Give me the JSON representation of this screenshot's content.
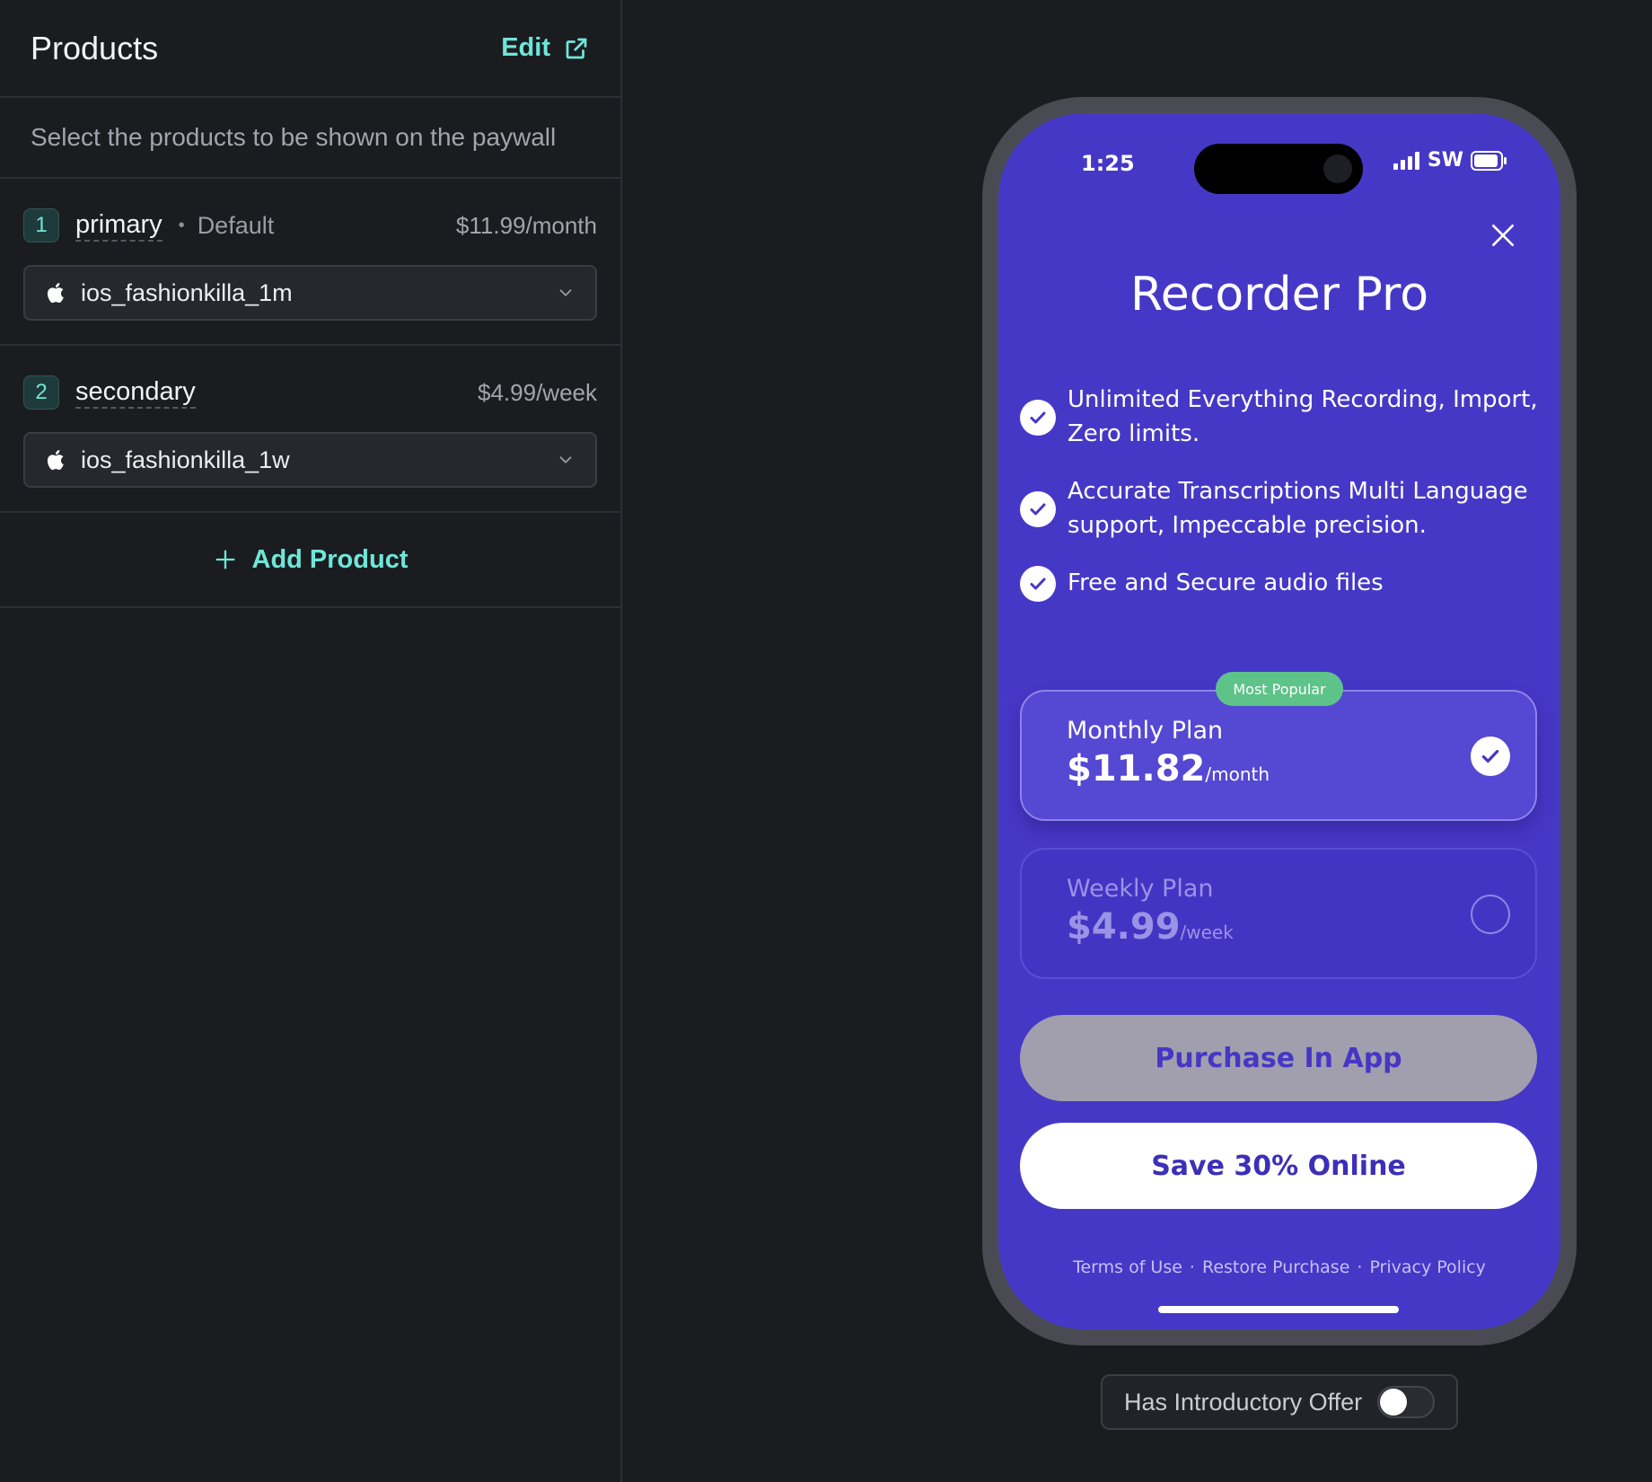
{
  "sidebar": {
    "title": "Products",
    "edit_label": "Edit",
    "description": "Select the products to be shown on the paywall",
    "products": [
      {
        "number": "1",
        "name": "primary",
        "tag": "Default",
        "price": "$11.99/month",
        "product_id": "ios_fashionkilla_1m"
      },
      {
        "number": "2",
        "name": "secondary",
        "tag": "",
        "price": "$4.99/week",
        "product_id": "ios_fashionkilla_1w"
      }
    ],
    "add_product_label": "Add Product"
  },
  "phone": {
    "status_time": "1:25",
    "carrier": "SW",
    "title": "Recorder Pro",
    "features": [
      "Unlimited Everything Recording, Import, Zero limits.",
      "Accurate Transcriptions Multi Language support, Impeccable precision.",
      "Free and Secure audio files"
    ],
    "badge": "Most Popular",
    "plans": [
      {
        "name": "Monthly Plan",
        "price": "$11.82",
        "period": "/month",
        "selected": true
      },
      {
        "name": "Weekly Plan",
        "price": "$4.99",
        "period": "/week",
        "selected": false
      }
    ],
    "purchase_button": "Purchase In App",
    "save_button": "Save 30% Online",
    "footer": {
      "terms": "Terms of Use",
      "restore": "Restore Purchase",
      "privacy": "Privacy Policy",
      "separator": "·"
    }
  },
  "intro_offer": {
    "label": "Has Introductory Offer",
    "enabled": false
  },
  "colors": {
    "accent": "#6ee6d8",
    "paywall_bg": "#4638c6",
    "badge_green": "#5ec389"
  }
}
